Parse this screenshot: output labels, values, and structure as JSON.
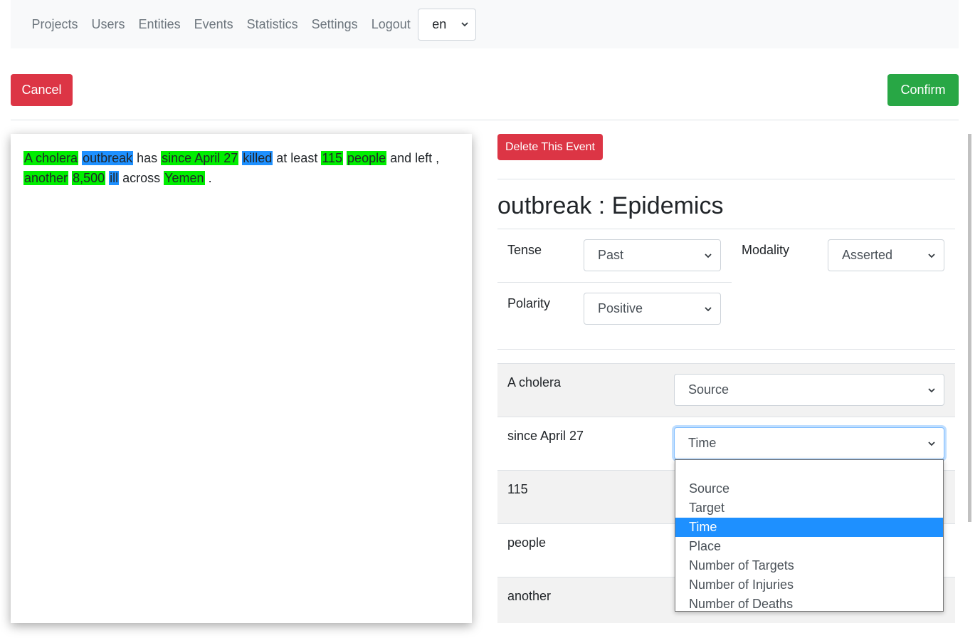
{
  "nav": {
    "links": [
      "Projects",
      "Users",
      "Entities",
      "Events",
      "Statistics",
      "Settings",
      "Logout"
    ],
    "language": "en"
  },
  "actions": {
    "cancel": "Cancel",
    "confirm": "Confirm",
    "delete_event": "Delete This Event"
  },
  "text": {
    "tokens": [
      {
        "t": "A cholera",
        "hl": "green"
      },
      {
        "t": " "
      },
      {
        "t": "outbreak",
        "hl": "blue"
      },
      {
        "t": " has "
      },
      {
        "t": "since April 27",
        "hl": "green"
      },
      {
        "t": " "
      },
      {
        "t": "killed",
        "hl": "blue"
      },
      {
        "t": " at least "
      },
      {
        "t": "115",
        "hl": "green"
      },
      {
        "t": " "
      },
      {
        "t": "people",
        "hl": "green"
      },
      {
        "t": " and left , "
      },
      {
        "t": "another",
        "hl": "green"
      },
      {
        "t": " "
      },
      {
        "t": "8,500",
        "hl": "green"
      },
      {
        "t": " "
      },
      {
        "t": "ill",
        "hl": "blue"
      },
      {
        "t": " across "
      },
      {
        "t": "Yemen",
        "hl": "green"
      },
      {
        "t": " ."
      }
    ]
  },
  "event": {
    "title": "outbreak : Epidemics",
    "tense_label": "Tense",
    "tense_value": "Past",
    "modality_label": "Modality",
    "modality_value": "Asserted",
    "polarity_label": "Polarity",
    "polarity_value": "Positive"
  },
  "arguments": [
    {
      "label": "A cholera",
      "role": "Source"
    },
    {
      "label": "since April 27",
      "role": "Time"
    },
    {
      "label": "115",
      "role": ""
    },
    {
      "label": "people",
      "role": ""
    },
    {
      "label": "another",
      "role": ""
    }
  ],
  "role_dropdown": {
    "options": [
      "",
      "Source",
      "Target",
      "Time",
      "Place",
      "Number of Targets",
      "Number of Injuries",
      "Number of Deaths"
    ],
    "selected": "Time"
  },
  "colors": {
    "highlight_green": "#00ee00",
    "highlight_blue": "#1e90ff",
    "danger": "#dc3545",
    "success": "#28a745"
  }
}
